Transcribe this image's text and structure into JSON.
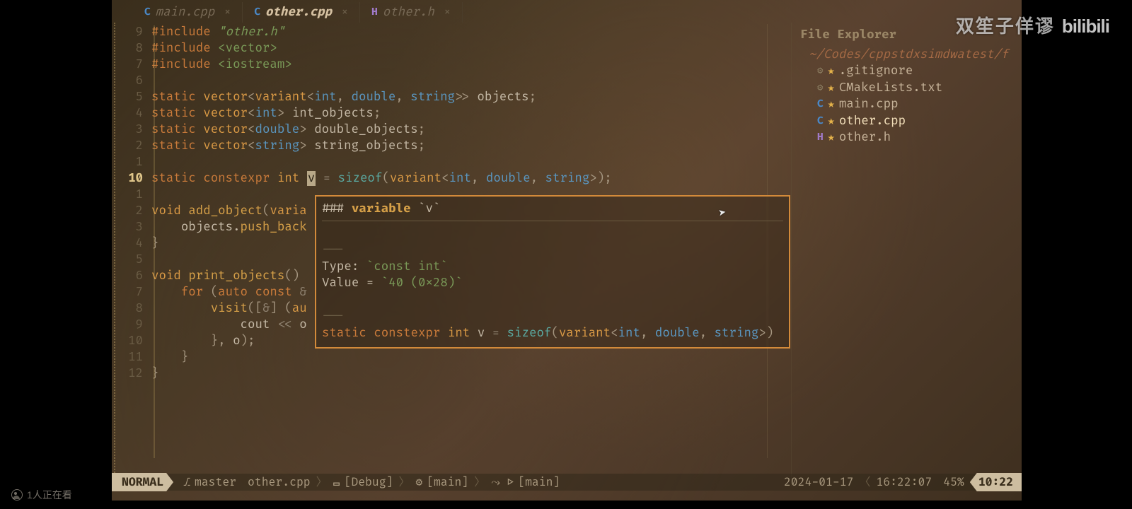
{
  "tabs": [
    {
      "name": "main.cpp",
      "icon": "cpp",
      "active": false,
      "close": "×"
    },
    {
      "name": "other.cpp",
      "icon": "cpp",
      "active": true,
      "close": "×"
    },
    {
      "name": "other.h",
      "icon": "h",
      "active": false,
      "close": "×"
    }
  ],
  "gutter": [
    "9",
    "8",
    "7",
    "6",
    "5",
    "4",
    "3",
    "2",
    "1",
    "10",
    "1",
    "2",
    "3",
    "4",
    "5",
    "6",
    "7",
    "8",
    "9",
    "10",
    "11",
    "12"
  ],
  "gutter_current_index": 9,
  "code_tokens": [
    [
      [
        "kw",
        "#include "
      ],
      [
        "str",
        "\"other.h\""
      ]
    ],
    [
      [
        "kw",
        "#include "
      ],
      [
        "inc",
        "<vector>"
      ]
    ],
    [
      [
        "kw",
        "#include "
      ],
      [
        "inc",
        "<iostream>"
      ]
    ],
    [],
    [
      [
        "kw",
        "static "
      ],
      [
        "ty",
        "vector"
      ],
      [
        "pun",
        "<"
      ],
      [
        "ty",
        "variant"
      ],
      [
        "pun",
        "<"
      ],
      [
        "hl",
        "int"
      ],
      [
        "pun",
        ", "
      ],
      [
        "hl",
        "double"
      ],
      [
        "pun",
        ", "
      ],
      [
        "hl",
        "string"
      ],
      [
        "pun",
        ">> "
      ],
      [
        "id",
        "objects"
      ],
      [
        "pun",
        ";"
      ]
    ],
    [
      [
        "kw",
        "static "
      ],
      [
        "ty",
        "vector"
      ],
      [
        "pun",
        "<"
      ],
      [
        "hl",
        "int"
      ],
      [
        "pun",
        "> "
      ],
      [
        "id",
        "int_objects"
      ],
      [
        "pun",
        ";"
      ]
    ],
    [
      [
        "kw",
        "static "
      ],
      [
        "ty",
        "vector"
      ],
      [
        "pun",
        "<"
      ],
      [
        "hl",
        "double"
      ],
      [
        "pun",
        "> "
      ],
      [
        "id",
        "double_objects"
      ],
      [
        "pun",
        ";"
      ]
    ],
    [
      [
        "kw",
        "static "
      ],
      [
        "ty",
        "vector"
      ],
      [
        "pun",
        "<"
      ],
      [
        "hl",
        "string"
      ],
      [
        "pun",
        "> "
      ],
      [
        "id",
        "string_objects"
      ],
      [
        "pun",
        ";"
      ]
    ],
    [],
    [
      [
        "kw",
        "static "
      ],
      [
        "kw",
        "constexpr "
      ],
      [
        "ty",
        "int "
      ],
      [
        "curs",
        "v"
      ],
      [
        "op",
        " = "
      ],
      [
        "fn",
        "sizeof"
      ],
      [
        "pun",
        "("
      ],
      [
        "ty",
        "variant"
      ],
      [
        "pun",
        "<"
      ],
      [
        "hl",
        "int"
      ],
      [
        "pun",
        ", "
      ],
      [
        "hl",
        "double"
      ],
      [
        "pun",
        ", "
      ],
      [
        "hl",
        "string"
      ],
      [
        "pun",
        ">"
      ],
      [
        "pun",
        ")"
      ],
      [
        "pun",
        ";"
      ]
    ],
    [],
    [
      [
        "ty",
        "void "
      ],
      [
        "fn2",
        "add_object"
      ],
      [
        "pun",
        "("
      ],
      [
        "ty",
        "varia"
      ]
    ],
    [
      [
        "id",
        "    objects."
      ],
      [
        "fn2",
        "push_back"
      ]
    ],
    [
      [
        "pun",
        "}"
      ]
    ],
    [],
    [
      [
        "ty",
        "void "
      ],
      [
        "fn2",
        "print_objects"
      ],
      [
        "pun",
        "()"
      ]
    ],
    [
      [
        "kw",
        "    for "
      ],
      [
        "pun",
        "("
      ],
      [
        "kw",
        "auto const "
      ],
      [
        "op",
        "&"
      ]
    ],
    [
      [
        "id",
        "        "
      ],
      [
        "fn2",
        "visit"
      ],
      [
        "pun",
        "(["
      ],
      [
        "op",
        "&"
      ],
      [
        "pun",
        "] ("
      ],
      [
        "ty",
        "au"
      ]
    ],
    [
      [
        "id",
        "            cout "
      ],
      [
        "op",
        "<<"
      ],
      [
        "id",
        " o"
      ]
    ],
    [
      [
        "pun",
        "        }, "
      ],
      [
        "id",
        "o"
      ],
      [
        "pun",
        ");"
      ]
    ],
    [
      [
        "pun",
        "    }"
      ]
    ],
    [
      [
        "pun",
        "}"
      ]
    ]
  ],
  "popup": {
    "header_prefix": "### ",
    "header_kw": "variable",
    "header_name": " `v`",
    "dash": "---",
    "type_label": "Type: ",
    "type_val": "`const int`",
    "value_label": "Value = ",
    "value_val": "`40 (0x28)`",
    "sig": [
      [
        "kw",
        "static "
      ],
      [
        "kw",
        "constexpr "
      ],
      [
        "ty",
        "int "
      ],
      [
        "id",
        "v "
      ],
      [
        "op",
        "= "
      ],
      [
        "fn",
        "sizeof"
      ],
      [
        "pun",
        "("
      ],
      [
        "ty",
        "variant"
      ],
      [
        "pun",
        "<"
      ],
      [
        "hl",
        "int"
      ],
      [
        "pun",
        ", "
      ],
      [
        "hl",
        "double"
      ],
      [
        "pun",
        ", "
      ],
      [
        "hl",
        "string"
      ],
      [
        "pun",
        ">"
      ],
      [
        "pun",
        ")"
      ]
    ]
  },
  "explorer": {
    "title": "File Explorer",
    "path": "~/Codes/cppstdxsimdwatest/f",
    "items": [
      {
        "icon": "gear",
        "name": ".gitignore"
      },
      {
        "icon": "gear",
        "name": "CMakeLists.txt"
      },
      {
        "icon": "cpp",
        "name": "main.cpp"
      },
      {
        "icon": "cpp",
        "name": "other.cpp",
        "sel": true
      },
      {
        "icon": "h",
        "name": "other.h"
      }
    ]
  },
  "status": {
    "mode": "NORMAL",
    "branch_icon": "⎇",
    "branch": "master",
    "file": "other.cpp",
    "crumb1": "[Debug]",
    "crumb2": "[main]",
    "crumb3": "[main]",
    "date": "2024-01-17",
    "time": "16:22:07",
    "percent": "45%",
    "pos": "10:22"
  },
  "watermark": {
    "cn": "双笙子佯谬",
    "logo": "bilibili",
    "viewers": "1人正在看"
  }
}
